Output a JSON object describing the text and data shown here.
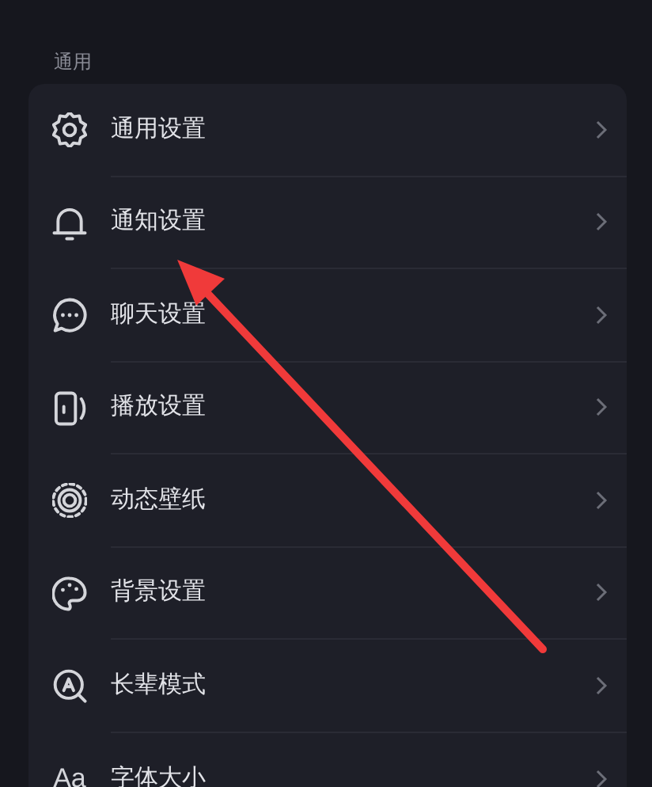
{
  "section_title": "通用",
  "items": [
    {
      "kind": "gear",
      "label": "通用设置"
    },
    {
      "kind": "bell",
      "label": "通知设置"
    },
    {
      "kind": "chat",
      "label": "聊天设置"
    },
    {
      "kind": "player",
      "label": "播放设置"
    },
    {
      "kind": "wallpaper",
      "label": "动态壁纸"
    },
    {
      "kind": "palette",
      "label": "背景设置"
    },
    {
      "kind": "elder",
      "label": "长辈模式"
    },
    {
      "kind": "font",
      "icon_text": "Aa",
      "label": "字体大小"
    }
  ]
}
